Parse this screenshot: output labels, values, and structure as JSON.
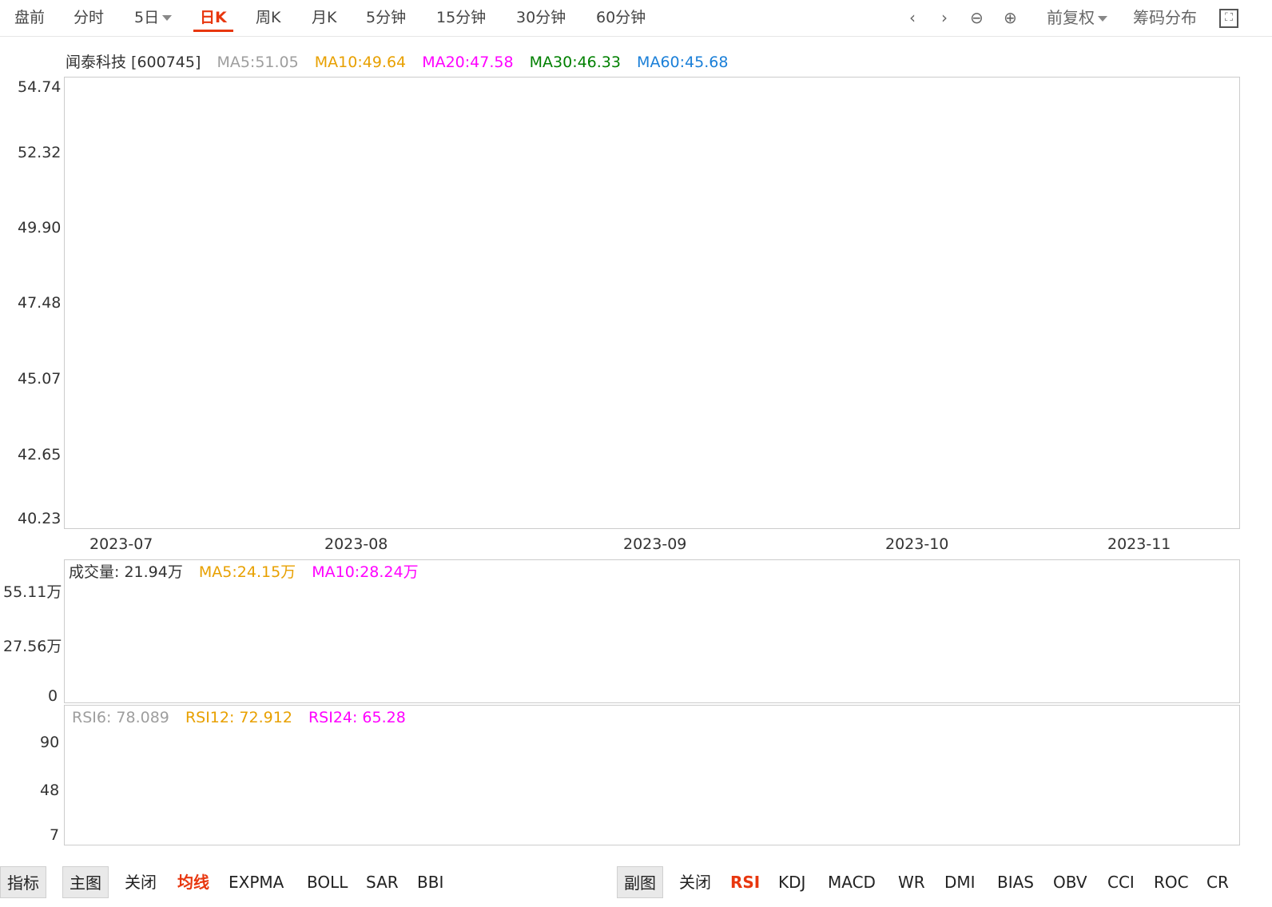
{
  "tabs": [
    "盘前",
    "分时",
    "5日",
    "日K",
    "周K",
    "月K",
    "5分钟",
    "15分钟",
    "30分钟",
    "60分钟"
  ],
  "controls": {
    "adjust": "前复权",
    "chips": "筹码分布"
  },
  "main": {
    "name": "闻泰科技 [600745]",
    "ma5": "MA5:51.05",
    "ma10": "MA10:49.64",
    "ma20": "MA20:47.58",
    "ma30": "MA30:46.33",
    "ma60": "MA60:45.68",
    "yticks": [
      "54.74",
      "52.32",
      "49.90",
      "47.48",
      "45.07",
      "42.65",
      "40.23"
    ],
    "xticks": [
      "2023-07",
      "2023-08",
      "2023-09",
      "2023-10",
      "2023-11"
    ]
  },
  "volume": {
    "label": "成交量: 21.94万",
    "ma5": "MA5:24.15万",
    "ma10": "MA10:28.24万",
    "yticks": [
      "55.11万",
      "27.56万",
      "0"
    ]
  },
  "rsi": {
    "rsi6": "RSI6: 78.089",
    "rsi12": "RSI12: 72.912",
    "rsi24": "RSI24: 65.28",
    "yticks": [
      "90",
      "48",
      "7"
    ]
  },
  "bottom": {
    "indicator_label": "指标",
    "main_label": "主图",
    "main_items": [
      "关闭",
      "均线",
      "EXPMA",
      "BOLL",
      "SAR",
      "BBI"
    ],
    "sub_label": "副图",
    "sub_items": [
      "关闭",
      "RSI",
      "KDJ",
      "MACD",
      "WR",
      "DMI",
      "BIAS",
      "OBV",
      "CCI",
      "ROC",
      "CR"
    ]
  },
  "colors": {
    "ma5": "#9e9e9e",
    "ma10": "#e8a000",
    "ma20": "#ff00ff",
    "ma30": "#008000",
    "ma60": "#1a7fd8",
    "active": "#e8370f"
  }
}
